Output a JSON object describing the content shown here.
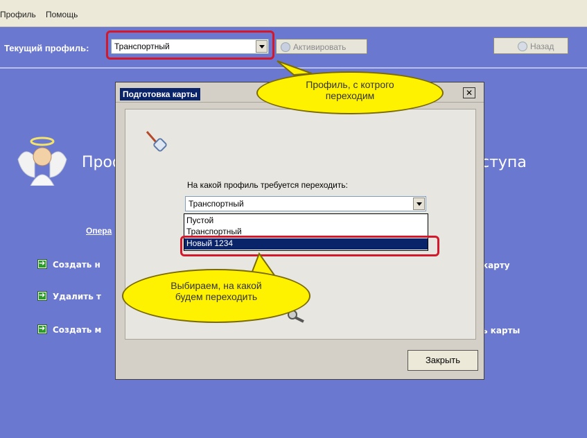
{
  "menu": {
    "items": [
      "Профиль",
      "Помощь"
    ]
  },
  "toolbar": {
    "current_profile_label": "Текущий профиль:",
    "current_profile_value": "Транспортный",
    "activate_label": "Активировать",
    "back_label": "Назад"
  },
  "main": {
    "title_left": "Проф",
    "title_right": "ступа",
    "ops_link": "Опера",
    "actions": [
      {
        "label": "Создать н"
      },
      {
        "label": "Удалить т"
      },
      {
        "label": "Создать м"
      }
    ],
    "actions_right": [
      "карту",
      "ь карты"
    ]
  },
  "dialog": {
    "title": "Подготовка карты",
    "close_glyph": "✕",
    "question": "На какой профиль требуется переходить:",
    "selected_value": "Транспортный",
    "options": [
      "Пустой",
      "Транспортный",
      "Новый 1234"
    ],
    "close_button": "Закрыть"
  },
  "callouts": {
    "top_line1": "Профиль, с котрого",
    "top_line2": "переходим",
    "bottom_line1": "Выбираем, на какой",
    "bottom_line2": "будем переходить"
  },
  "colors": {
    "app_background": "#6b78d0",
    "highlight": "#d2182a",
    "callout": "#fff200",
    "selection": "#0a246a"
  }
}
